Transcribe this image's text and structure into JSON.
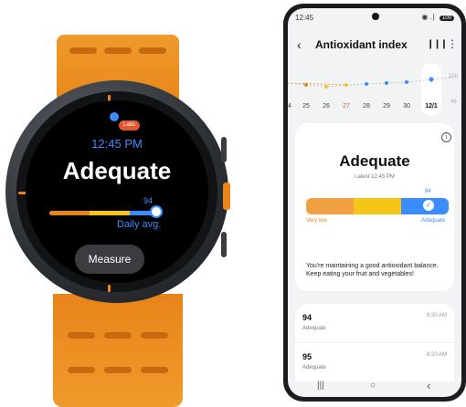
{
  "watch": {
    "badge": "Labs",
    "time": "12:45 PM",
    "status": "Adequate",
    "value": "94",
    "daily_avg_label": "Daily avg.",
    "measure_button": "Measure"
  },
  "phone": {
    "status_bar": {
      "time": "12:45",
      "icons": "◉ .∣",
      "battery": "100"
    },
    "header": {
      "title": "Antioxidant index",
      "back_icon": "‹",
      "chart_icon": "❙❙❙",
      "more_icon": "⋮"
    },
    "trend": {
      "dates": [
        "4",
        "25",
        "26",
        "27",
        "28",
        "29",
        "30",
        "12/1"
      ],
      "y_top": "100",
      "y_mid": "46"
    },
    "card": {
      "status": "Adequate",
      "latest": "Latest 12:45 PM",
      "value": "94",
      "low_label": "Very low",
      "adequate_label": "Adequate",
      "message": "You're maintaining a good antioxidant balance. Keep eating your fruit and vegetables!"
    },
    "records": [
      {
        "value": "94",
        "status": "Adequate",
        "time": "8:30 AM"
      },
      {
        "value": "95",
        "status": "Adequate",
        "time": "8:20 AM"
      }
    ],
    "nav": {
      "recents": "|||",
      "home": "○",
      "back": "‹"
    }
  },
  "colors": {
    "band_orange": "#e8841a",
    "accent_blue": "#3a8cff",
    "yellow": "#f5c518",
    "low_red": "#e4572e"
  }
}
